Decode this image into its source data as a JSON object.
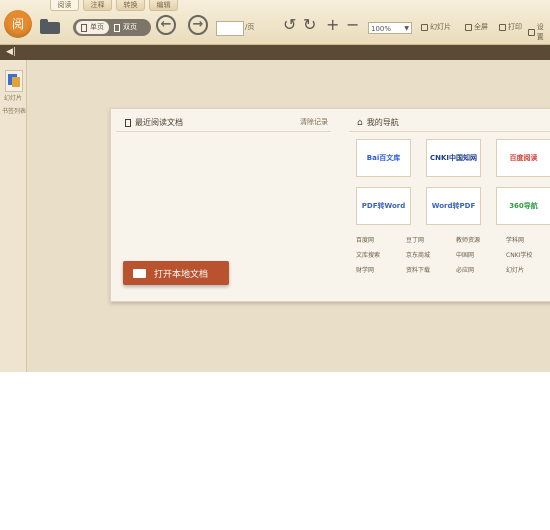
{
  "toolbar": {
    "logo": "阅",
    "menus": [
      "阅读",
      "注释",
      "转换",
      "编辑"
    ],
    "view_single": "单页",
    "view_double": "双页",
    "page_total": "/页",
    "zoom": "100%",
    "btn_slideshow": "幻灯片",
    "btn_fullscreen": "全屏",
    "btn_print": "打印",
    "btn_settings": "设置"
  },
  "sidebar": {
    "thumb_label": "幻灯片",
    "footer_label": "书签列表"
  },
  "recent": {
    "title": "最近阅读文档",
    "clear": "清除记录",
    "open_button": "打开本地文档"
  },
  "nav": {
    "title": "我的导航",
    "cards": [
      "Bai百文库",
      "CNKI中国知网",
      "百度阅读",
      "PDF转Word",
      "Word转PDF",
      "360导航"
    ],
    "links": [
      [
        "百度网",
        "豆丁网",
        "教师资源",
        "学科网"
      ],
      [
        "文库搜索",
        "京东商城",
        "中国网",
        "CNKI学校"
      ],
      [
        "财学网",
        "资料下载",
        "必应网",
        "幻灯片"
      ]
    ]
  },
  "colors": {
    "accent": "#b8522f",
    "toolbar_bg": "#eadcbc",
    "subbar": "#5b4a36"
  }
}
